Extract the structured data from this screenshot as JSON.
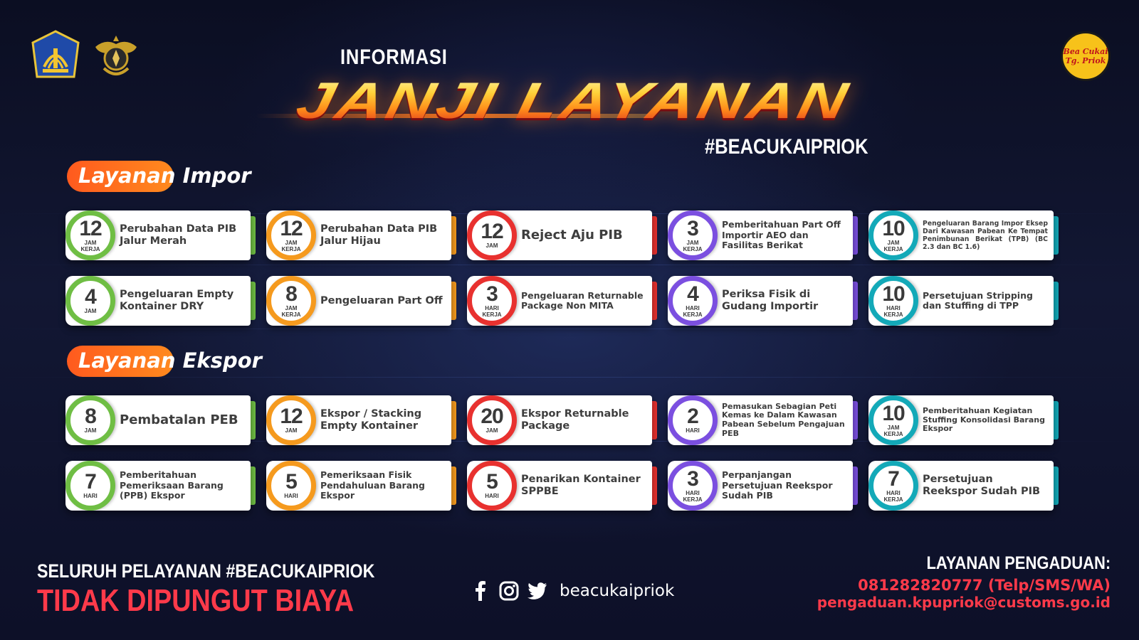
{
  "header": {
    "info_label": "INFORMASI",
    "title": "JANJI LAYANAN",
    "hashtag": "#BEACUKAIPRIOK",
    "priok_logo_line1": "Bea Cukai",
    "priok_logo_line2": "Tg. Priok"
  },
  "colors": {
    "green": "#6fbe44",
    "orange": "#f59a1e",
    "red": "#e8312f",
    "purple": "#7b4fe0",
    "teal": "#13a9b8",
    "accent_red": "#ff3a4a"
  },
  "sections": {
    "impor": {
      "title": "Layanan Impor",
      "rows": [
        [
          {
            "num": "12",
            "unit": "JAM\nKERJA",
            "label": "Perubahan Data PIB Jalur Merah",
            "color": "green",
            "size": "m"
          },
          {
            "num": "12",
            "unit": "JAM\nKERJA",
            "label": "Perubahan Data PIB Jalur Hijau",
            "color": "orange",
            "size": "m"
          },
          {
            "num": "12",
            "unit": "JAM",
            "label": "Reject Aju PIB",
            "color": "red",
            "size": "l"
          },
          {
            "num": "3",
            "unit": "JAM\nKERJA",
            "label": "Pemberitahuan Part Off Importir AEO dan Fasilitas Berikat",
            "color": "purple",
            "size": "s"
          },
          {
            "num": "10",
            "unit": "JAM\nKERJA",
            "label": "Pengeluaran Barang Impor Eksep Dari Kawasan Pabean Ke Tempat Penimbunan Berikat (TPB) (BC 2.3 dan BC 1.6)",
            "color": "teal",
            "size": "xxs"
          }
        ],
        [
          {
            "num": "4",
            "unit": "JAM",
            "label": "Pengeluaran Empty Kontainer DRY",
            "color": "green",
            "size": "m"
          },
          {
            "num": "8",
            "unit": "JAM\nKERJA",
            "label": "Pengeluaran Part Off",
            "color": "orange",
            "size": "m"
          },
          {
            "num": "3",
            "unit": "HARI\nKERJA",
            "label": "Pengeluaran Returnable Package Non MITA",
            "color": "red",
            "size": "s"
          },
          {
            "num": "4",
            "unit": "HARI\nKERJA",
            "label": "Periksa Fisik di Gudang Importir",
            "color": "purple",
            "size": "m"
          },
          {
            "num": "10",
            "unit": "HARI\nKERJA",
            "label": "Persetujuan Stripping dan Stuffing di TPP",
            "color": "teal",
            "size": "s"
          }
        ]
      ]
    },
    "ekspor": {
      "title": "Layanan Ekspor",
      "rows": [
        [
          {
            "num": "8",
            "unit": "JAM",
            "label": "Pembatalan PEB",
            "color": "green",
            "size": "l"
          },
          {
            "num": "12",
            "unit": "JAM",
            "label": "Ekspor / Stacking Empty Kontainer",
            "color": "orange",
            "size": "m"
          },
          {
            "num": "20",
            "unit": "JAM",
            "label": "Ekspor Returnable Package",
            "color": "red",
            "size": "m"
          },
          {
            "num": "2",
            "unit": "HARI",
            "label": "Pemasukan Sebagian Peti Kemas ke Dalam Kawasan Pabean Sebelum Pengajuan PEB",
            "color": "purple",
            "size": "xs"
          },
          {
            "num": "10",
            "unit": "JAM\nKERJA",
            "label": "Pemberitahuan Kegiatan Stuffing Konsolidasi Barang Ekspor",
            "color": "teal",
            "size": "xs"
          }
        ],
        [
          {
            "num": "7",
            "unit": "HARI",
            "label": "Pemberitahuan Pemeriksaan Barang (PPB) Ekspor",
            "color": "green",
            "size": "s"
          },
          {
            "num": "5",
            "unit": "HARI",
            "label": "Pemeriksaan Fisik Pendahuluan Barang Ekspor",
            "color": "orange",
            "size": "s"
          },
          {
            "num": "5",
            "unit": "HARI",
            "label": "Penarikan Kontainer SPPBE",
            "color": "red",
            "size": "m"
          },
          {
            "num": "3",
            "unit": "HARI\nKERJA",
            "label": "Perpanjangan Persetujuan Reekspor Sudah PIB",
            "color": "purple",
            "size": "s"
          },
          {
            "num": "7",
            "unit": "HARI\nKERJA",
            "label": "Persetujuan Reekspor Sudah PIB",
            "color": "teal",
            "size": "m"
          }
        ]
      ]
    }
  },
  "footer": {
    "free_line1": "SELURUH PELAYANAN #BEACUKAIPRIOK",
    "free_line2": "TIDAK DIPUNGUT BIAYA",
    "social_handle": "beacukaipriok",
    "social_icons": [
      "facebook-icon",
      "instagram-icon",
      "twitter-icon"
    ],
    "complaint_title": "LAYANAN PENGADUAN:",
    "complaint_phone": "081282820777 (Telp/SMS/WA)",
    "complaint_email": "pengaduan.kpupriok@customs.go.id"
  }
}
